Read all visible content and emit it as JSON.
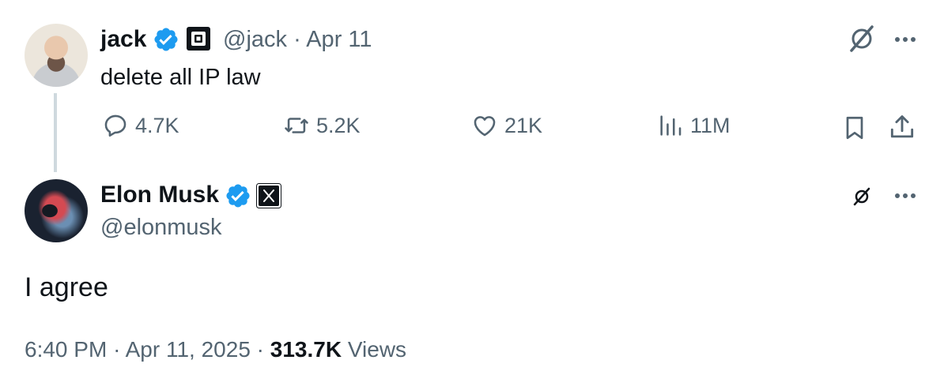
{
  "parent_tweet": {
    "author_name": "jack",
    "handle": "@jack",
    "separator": "·",
    "date": "Apr 11",
    "text": "delete all IP law",
    "stats": {
      "replies": "4.7K",
      "reposts": "5.2K",
      "likes": "21K",
      "views": "11M"
    }
  },
  "main_tweet": {
    "author_name": "Elon Musk",
    "handle": "@elonmusk",
    "text": "I agree",
    "time": "6:40 PM",
    "date": "Apr 11, 2025",
    "separator": "·",
    "views_count": "313.7K",
    "views_label": "Views"
  },
  "colors": {
    "text_primary": "#0f1419",
    "text_secondary": "#536471",
    "verified_blue": "#1d9bf0",
    "thread_line": "#cfd9de"
  },
  "icons": [
    "verified-icon",
    "square-logo-icon",
    "x-logo-icon",
    "grok-icon",
    "more-icon",
    "reply-icon",
    "retweet-icon",
    "like-icon",
    "views-icon",
    "bookmark-icon",
    "share-icon"
  ]
}
